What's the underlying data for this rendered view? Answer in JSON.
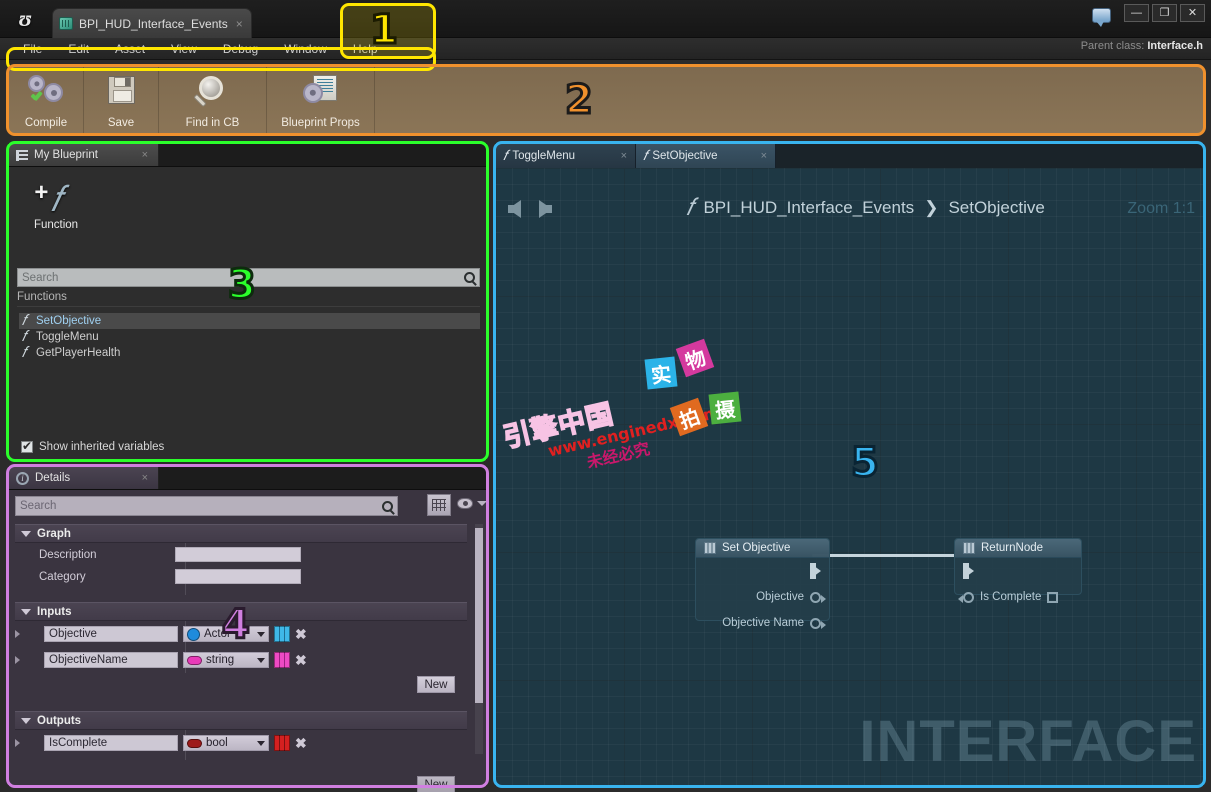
{
  "window": {
    "app": "Unreal Engine Blueprint Editor",
    "tab_title": "BPI_HUD_Interface_Events",
    "tab_close": "×",
    "minimize": "—",
    "maximize": "❐",
    "close": "✕",
    "parent_class_label": "Parent class:",
    "parent_class_value": "Interface.h"
  },
  "menubar": {
    "items": [
      "File",
      "Edit",
      "Asset",
      "View",
      "Debug",
      "Window",
      "Help"
    ]
  },
  "toolbar": {
    "buttons": [
      {
        "label": "Compile",
        "icon": "compile-gear-check-icon"
      },
      {
        "label": "Save",
        "icon": "floppy-disk-icon"
      },
      {
        "label": "Find in CB",
        "icon": "magnifier-icon"
      },
      {
        "label": "Blueprint Props",
        "icon": "blueprint-properties-icon"
      }
    ]
  },
  "my_blueprint": {
    "tab_label": "My Blueprint",
    "tab_close": "×",
    "add_function_label": "Function",
    "search_placeholder": "Search",
    "section_header": "Functions",
    "functions": [
      {
        "name": "SetObjective",
        "selected": true
      },
      {
        "name": "ToggleMenu",
        "selected": false
      },
      {
        "name": "GetPlayerHealth",
        "selected": false
      }
    ],
    "show_inherited_label": "Show inherited variables",
    "show_inherited_checked": true
  },
  "details": {
    "tab_label": "Details",
    "tab_close": "×",
    "search_placeholder": "Search",
    "sections": [
      {
        "title": "Graph",
        "rows": [
          {
            "label": "Description",
            "value": ""
          },
          {
            "label": "Category",
            "value": ""
          }
        ]
      }
    ],
    "inputs": {
      "title": "Inputs",
      "rows": [
        {
          "name": "Objective",
          "type": "Actor",
          "type_color": "#1f8bdc",
          "type_shape": "circle",
          "grid_color": "#3fb8e8"
        },
        {
          "name": "ObjectiveName",
          "type": "string",
          "type_color": "#e83ab8",
          "type_shape": "pill",
          "grid_color": "#ee4ac4"
        }
      ],
      "new_label": "New"
    },
    "outputs": {
      "title": "Outputs",
      "rows": [
        {
          "name": "IsComplete",
          "type": "bool",
          "type_color": "#9e1b1b",
          "type_shape": "pill",
          "grid_color": "#d42020"
        }
      ],
      "new_label": "New"
    }
  },
  "graph": {
    "tabs": [
      {
        "label": "ToggleMenu",
        "active": false,
        "close": "×"
      },
      {
        "label": "SetObjective",
        "active": true,
        "close": "×"
      }
    ],
    "breadcrumb": {
      "root": "BPI_HUD_Interface_Events",
      "separator": "❯",
      "leaf": "SetObjective"
    },
    "zoom_label": "Zoom 1:1",
    "back_icon": "arrow-left-icon",
    "forward_icon": "arrow-right-icon",
    "nodes": [
      {
        "title": "Set Objective",
        "exec_out": true,
        "pins": [
          {
            "label": "Objective",
            "kind": "object"
          },
          {
            "label": "Objective Name",
            "kind": "string"
          }
        ]
      },
      {
        "title": "ReturnNode",
        "exec_in": true,
        "pins": [
          {
            "label": "Is Complete",
            "kind": "bool"
          }
        ]
      }
    ],
    "watermark_big": "INTERFACE"
  },
  "watermarks": {
    "cn_brand": "引擎中国",
    "url": "www.enginedx.com",
    "url_shadow": "未经必究",
    "tiles": [
      {
        "char": "实",
        "bg": "#2bb3e8"
      },
      {
        "char": "物",
        "bg": "#d4399e"
      },
      {
        "char": "拍",
        "bg": "#e06a20"
      },
      {
        "char": "摄",
        "bg": "#4caf3f"
      }
    ]
  },
  "callouts": [
    {
      "number": "1",
      "color": "#ffe600",
      "region": "menu-bar-and-title"
    },
    {
      "number": "2",
      "color": "#f0912d",
      "region": "toolbar"
    },
    {
      "number": "3",
      "color": "#2bff2b",
      "region": "my-blueprint-panel"
    },
    {
      "number": "4",
      "color": "#d07fe0",
      "region": "details-panel"
    },
    {
      "number": "5",
      "color": "#39b4ef",
      "region": "graph-editor"
    }
  ]
}
